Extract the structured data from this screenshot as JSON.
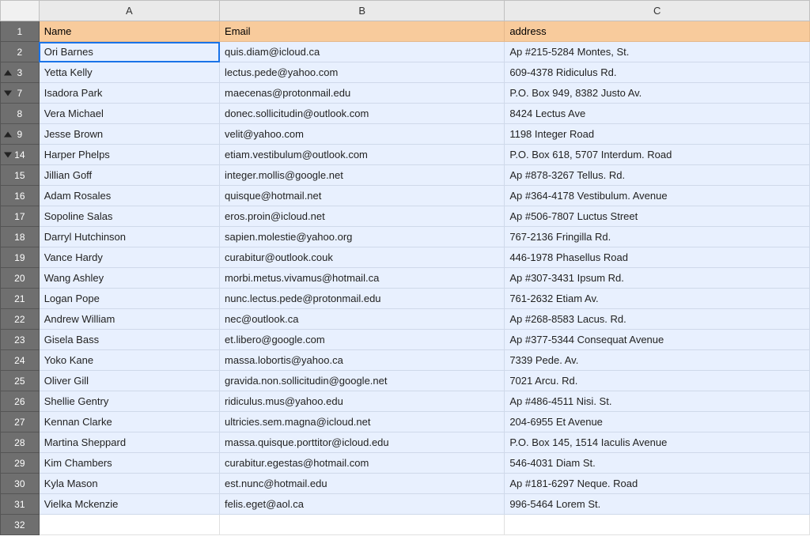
{
  "columns": [
    "A",
    "B",
    "C"
  ],
  "header": {
    "name": "Name",
    "email": "Email",
    "address": "address"
  },
  "rowHeaders": [
    "1",
    "2",
    "3",
    "7",
    "8",
    "9",
    "14",
    "15",
    "16",
    "17",
    "18",
    "19",
    "20",
    "21",
    "22",
    "23",
    "24",
    "25",
    "26",
    "27",
    "28",
    "29",
    "30",
    "31",
    "32"
  ],
  "rowMarkers": {
    "1": "",
    "2": "",
    "3": "up",
    "7": "down",
    "8": "",
    "9": "up",
    "14": "down"
  },
  "rows": [
    {
      "name": "Ori Barnes",
      "email": "quis.diam@icloud.ca",
      "address": "Ap #215-5284 Montes, St."
    },
    {
      "name": "Yetta Kelly",
      "email": "lectus.pede@yahoo.com",
      "address": "609-4378 Ridiculus Rd."
    },
    {
      "name": "Isadora Park",
      "email": "maecenas@protonmail.edu",
      "address": "P.O. Box 949, 8382 Justo Av."
    },
    {
      "name": "Vera Michael",
      "email": "donec.sollicitudin@outlook.com",
      "address": "8424 Lectus Ave"
    },
    {
      "name": "Jesse Brown",
      "email": "velit@yahoo.com",
      "address": "1198 Integer Road"
    },
    {
      "name": "Harper Phelps",
      "email": "etiam.vestibulum@outlook.com",
      "address": "P.O. Box 618, 5707 Interdum. Road"
    },
    {
      "name": "Jillian Goff",
      "email": "integer.mollis@google.net",
      "address": "Ap #878-3267 Tellus. Rd."
    },
    {
      "name": "Adam Rosales",
      "email": "quisque@hotmail.net",
      "address": "Ap #364-4178 Vestibulum. Avenue"
    },
    {
      "name": "Sopoline Salas",
      "email": "eros.proin@icloud.net",
      "address": "Ap #506-7807 Luctus Street"
    },
    {
      "name": "Darryl Hutchinson",
      "email": "sapien.molestie@yahoo.org",
      "address": "767-2136 Fringilla Rd."
    },
    {
      "name": "Vance Hardy",
      "email": "curabitur@outlook.couk",
      "address": "446-1978 Phasellus Road"
    },
    {
      "name": "Wang Ashley",
      "email": "morbi.metus.vivamus@hotmail.ca",
      "address": "Ap #307-3431 Ipsum Rd."
    },
    {
      "name": "Logan Pope",
      "email": "nunc.lectus.pede@protonmail.edu",
      "address": "761-2632 Etiam Av."
    },
    {
      "name": "Andrew William",
      "email": "nec@outlook.ca",
      "address": "Ap #268-8583 Lacus. Rd."
    },
    {
      "name": "Gisela Bass",
      "email": "et.libero@google.com",
      "address": "Ap #377-5344 Consequat Avenue"
    },
    {
      "name": "Yoko Kane",
      "email": "massa.lobortis@yahoo.ca",
      "address": "7339 Pede. Av."
    },
    {
      "name": "Oliver Gill",
      "email": "gravida.non.sollicitudin@google.net",
      "address": "7021 Arcu. Rd."
    },
    {
      "name": "Shellie Gentry",
      "email": "ridiculus.mus@yahoo.edu",
      "address": "Ap #486-4511 Nisi. St."
    },
    {
      "name": "Kennan Clarke",
      "email": "ultricies.sem.magna@icloud.net",
      "address": "204-6955 Et Avenue"
    },
    {
      "name": "Martina Sheppard",
      "email": "massa.quisque.porttitor@icloud.edu",
      "address": "P.O. Box 145, 1514 Iaculis Avenue"
    },
    {
      "name": "Kim Chambers",
      "email": "curabitur.egestas@hotmail.com",
      "address": "546-4031 Diam St."
    },
    {
      "name": "Kyla Mason",
      "email": "est.nunc@hotmail.edu",
      "address": "Ap #181-6297 Neque. Road"
    },
    {
      "name": "Vielka Mckenzie",
      "email": "felis.eget@aol.ca",
      "address": "996-5464 Lorem St."
    }
  ],
  "chart_data": {
    "type": "table",
    "columns": [
      "Name",
      "Email",
      "address"
    ],
    "data": [
      [
        "Ori Barnes",
        "quis.diam@icloud.ca",
        "Ap #215-5284 Montes, St."
      ],
      [
        "Yetta Kelly",
        "lectus.pede@yahoo.com",
        "609-4378 Ridiculus Rd."
      ],
      [
        "Isadora Park",
        "maecenas@protonmail.edu",
        "P.O. Box 949, 8382 Justo Av."
      ],
      [
        "Vera Michael",
        "donec.sollicitudin@outlook.com",
        "8424 Lectus Ave"
      ],
      [
        "Jesse Brown",
        "velit@yahoo.com",
        "1198 Integer Road"
      ],
      [
        "Harper Phelps",
        "etiam.vestibulum@outlook.com",
        "P.O. Box 618, 5707 Interdum. Road"
      ],
      [
        "Jillian Goff",
        "integer.mollis@google.net",
        "Ap #878-3267 Tellus. Rd."
      ],
      [
        "Adam Rosales",
        "quisque@hotmail.net",
        "Ap #364-4178 Vestibulum. Avenue"
      ],
      [
        "Sopoline Salas",
        "eros.proin@icloud.net",
        "Ap #506-7807 Luctus Street"
      ],
      [
        "Darryl Hutchinson",
        "sapien.molestie@yahoo.org",
        "767-2136 Fringilla Rd."
      ],
      [
        "Vance Hardy",
        "curabitur@outlook.couk",
        "446-1978 Phasellus Road"
      ],
      [
        "Wang Ashley",
        "morbi.metus.vivamus@hotmail.ca",
        "Ap #307-3431 Ipsum Rd."
      ],
      [
        "Logan Pope",
        "nunc.lectus.pede@protonmail.edu",
        "761-2632 Etiam Av."
      ],
      [
        "Andrew William",
        "nec@outlook.ca",
        "Ap #268-8583 Lacus. Rd."
      ],
      [
        "Gisela Bass",
        "et.libero@google.com",
        "Ap #377-5344 Consequat Avenue"
      ],
      [
        "Yoko Kane",
        "massa.lobortis@yahoo.ca",
        "7339 Pede. Av."
      ],
      [
        "Oliver Gill",
        "gravida.non.sollicitudin@google.net",
        "7021 Arcu. Rd."
      ],
      [
        "Shellie Gentry",
        "ridiculus.mus@yahoo.edu",
        "Ap #486-4511 Nisi. St."
      ],
      [
        "Kennan Clarke",
        "ultricies.sem.magna@icloud.net",
        "204-6955 Et Avenue"
      ],
      [
        "Martina Sheppard",
        "massa.quisque.porttitor@icloud.edu",
        "P.O. Box 145, 1514 Iaculis Avenue"
      ],
      [
        "Kim Chambers",
        "curabitur.egestas@hotmail.com",
        "546-4031 Diam St."
      ],
      [
        "Kyla Mason",
        "est.nunc@hotmail.edu",
        "Ap #181-6297 Neque. Road"
      ],
      [
        "Vielka Mckenzie",
        "felis.eget@aol.ca",
        "996-5464 Lorem St."
      ]
    ]
  }
}
